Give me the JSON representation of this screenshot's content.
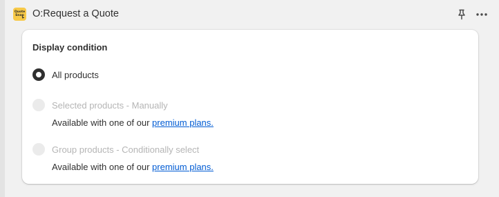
{
  "header": {
    "title": "O:Request a Quote",
    "app_icon_text_line1": "Quote",
    "app_icon_text_line2": "Snap",
    "pin_icon": "pin-icon",
    "more_icon": "more-horizontal-icon"
  },
  "card": {
    "section_title": "Display condition",
    "options": [
      {
        "label": "All products",
        "selected": true,
        "disabled": false
      },
      {
        "label": "Selected products - Manually",
        "selected": false,
        "disabled": true,
        "helper_prefix": "Available with one of our ",
        "helper_link": "premium plans."
      },
      {
        "label": "Group products - Conditionally select",
        "selected": false,
        "disabled": true,
        "helper_prefix": "Available with one of our ",
        "helper_link": "premium plans."
      }
    ]
  },
  "colors": {
    "background": "#f1f1f1",
    "card": "#ffffff",
    "text": "#303030",
    "disabled_text": "#b5b5b5",
    "link": "#005bd3",
    "app_icon": "#f7c948"
  }
}
